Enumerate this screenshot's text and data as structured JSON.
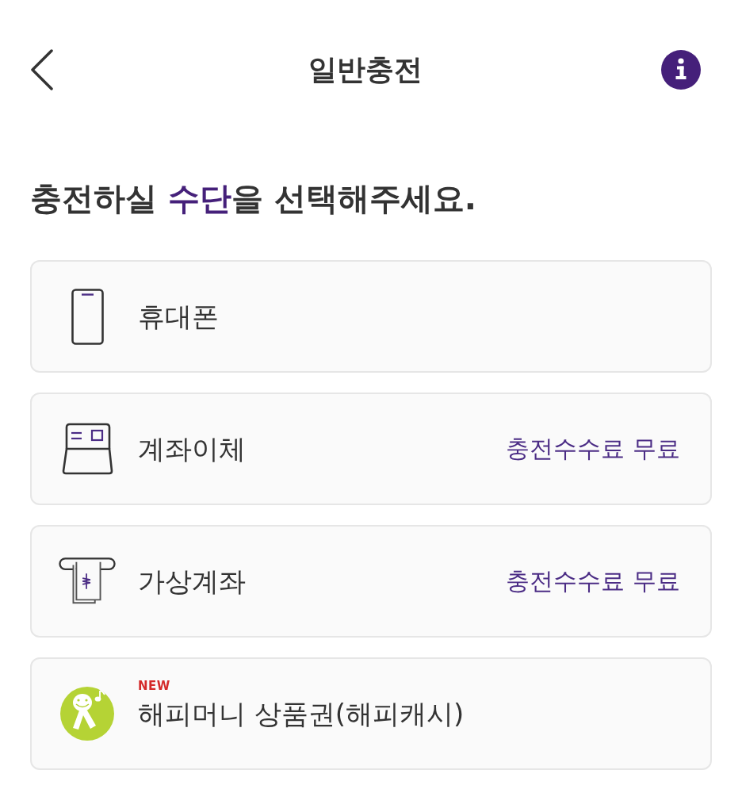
{
  "header": {
    "title": "일반충전"
  },
  "heading": {
    "before": "충전하실 ",
    "highlight": "수단",
    "after": "을 선택해주세요."
  },
  "methods": [
    {
      "kind": "phone",
      "label": "휴대폰"
    },
    {
      "kind": "bank_transfer",
      "label": "계좌이체",
      "note": "충전수수료 무료"
    },
    {
      "kind": "virtual_account",
      "label": "가상계좌",
      "note": "충전수수료 무료"
    },
    {
      "kind": "gift_card",
      "label": "해피머니 상품권(해피캐시)",
      "badge": "NEW"
    }
  ]
}
